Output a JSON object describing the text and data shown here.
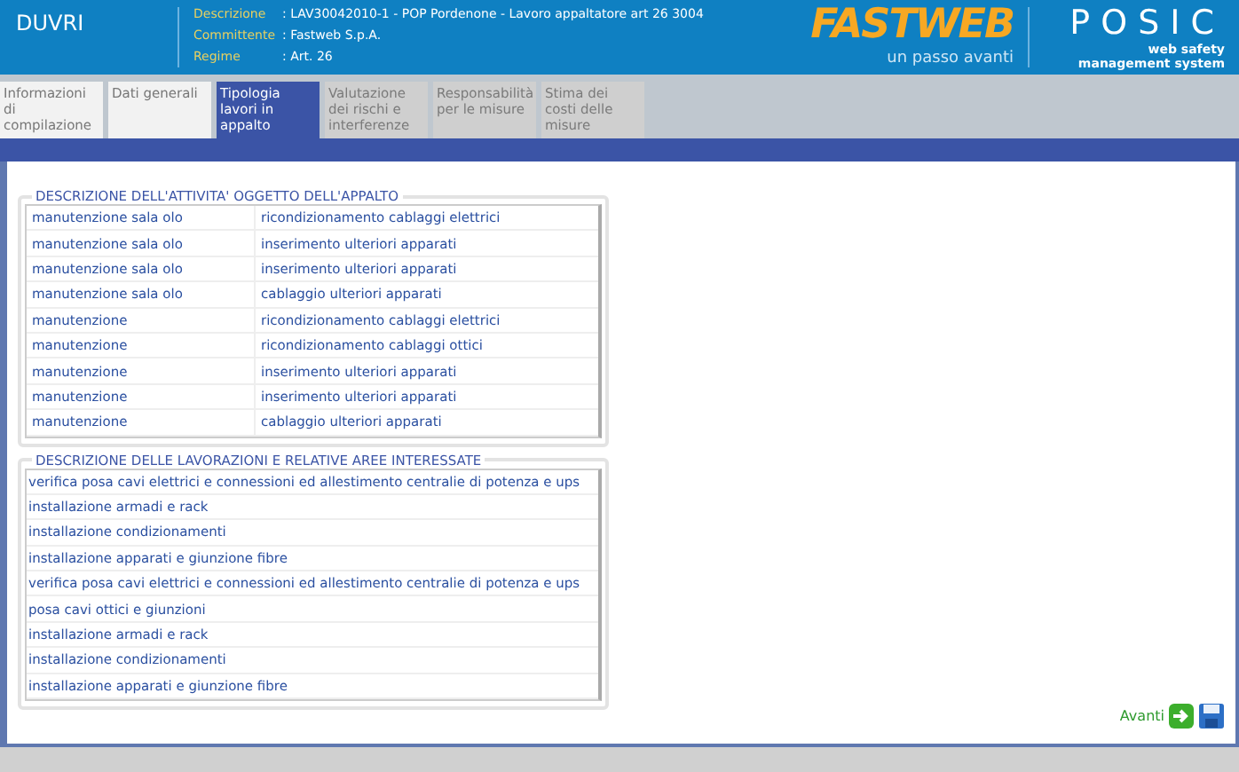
{
  "header": {
    "title": "DUVRI",
    "fields": [
      {
        "label": "Descrizione",
        "value": ": LAV30042010-1 - POP Pordenone - Lavoro appaltatore art 26 3004"
      },
      {
        "label": "Committente",
        "value": ": Fastweb S.p.A."
      },
      {
        "label": "Regime",
        "value": ": Art. 26"
      }
    ],
    "logo": {
      "name": "FASTWEB",
      "tagline": "un passo avanti"
    },
    "product": {
      "name": "POSIC",
      "tagline": "web safety",
      "tagline_2": "management system"
    }
  },
  "tabs": [
    {
      "label": "Informazioni di compilazione",
      "selected": false,
      "disabled": false
    },
    {
      "label": "Dati generali",
      "selected": false,
      "disabled": false
    },
    {
      "label": "Tipologia lavori in appalto",
      "selected": true,
      "disabled": false
    },
    {
      "label": "Valutazione dei rischi e interferenze",
      "selected": false,
      "disabled": true
    },
    {
      "label": "Responsabilità per le misure",
      "selected": false,
      "disabled": true
    },
    {
      "label": "Stima dei costi delle misure",
      "selected": false,
      "disabled": true
    }
  ],
  "activities": {
    "title": "DESCRIZIONE DELL'ATTIVITA' OGGETTO DELL'APPALTO",
    "rows": [
      [
        "manutenzione sala olo",
        "ricondizionamento cablaggi elettrici"
      ],
      [
        "manutenzione sala olo",
        "inserimento ulteriori apparati"
      ],
      [
        "manutenzione sala olo",
        "inserimento ulteriori apparati"
      ],
      [
        "manutenzione sala olo",
        "cablaggio ulteriori apparati"
      ],
      [
        "manutenzione",
        "ricondizionamento cablaggi elettrici"
      ],
      [
        "manutenzione",
        "ricondizionamento cablaggi ottici"
      ],
      [
        "manutenzione",
        "inserimento ulteriori apparati"
      ],
      [
        "manutenzione",
        "inserimento ulteriori apparati"
      ],
      [
        "manutenzione",
        "cablaggio ulteriori apparati"
      ]
    ]
  },
  "works": {
    "title": "DESCRIZIONE DELLE LAVORAZIONI E RELATIVE AREE INTERESSATE",
    "rows": [
      "verifica posa cavi elettrici e connessioni ed allestimento centralie di potenza e ups",
      "installazione armadi e rack",
      "installazione condizionamenti",
      "installazione apparati e giunzione fibre",
      "verifica posa cavi elettrici e connessioni ed allestimento centralie di potenza e ups",
      "posa cavi ottici e giunzioni",
      "installazione armadi e rack",
      "installazione condizionamenti",
      "installazione apparati e giunzione fibre"
    ]
  },
  "footer": {
    "next": "Avanti"
  }
}
